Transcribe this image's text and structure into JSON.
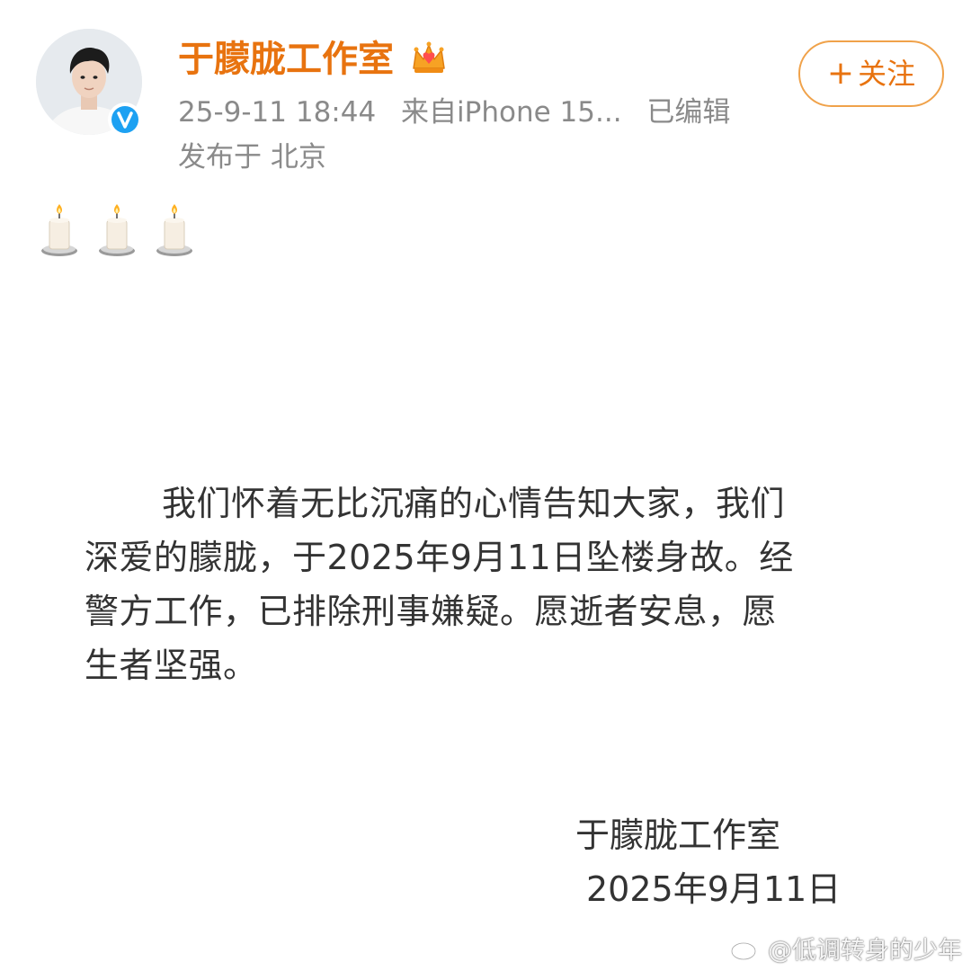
{
  "post": {
    "author": "于朦胧工作室",
    "timestamp": "25-9-11 18:44",
    "source": "来自iPhone 15...",
    "edited": "已编辑",
    "location": "发布于 北京",
    "follow_label": "关注",
    "follow_plus": "+",
    "emoji_icons": [
      "candle-icon",
      "candle-icon",
      "candle-icon"
    ]
  },
  "announcement": {
    "lines": [
      "我们怀着无比沉痛的心情告知大家，我们",
      "深爱的朦胧，于2025年9月11日坠楼身故。经",
      "警方工作，已排除刑事嫌疑。愿逝者安息，愿",
      "生者坚强。"
    ],
    "signature_name": "于朦胧工作室",
    "signature_date": "2025年9月11日"
  },
  "watermark": {
    "text": "@低调转身的少年"
  },
  "colors": {
    "username": "#e8730f",
    "follow_border": "#f0a24a",
    "meta": "#8a8a8a",
    "body_text": "#333333",
    "verified_badge": "#1da1f2"
  }
}
